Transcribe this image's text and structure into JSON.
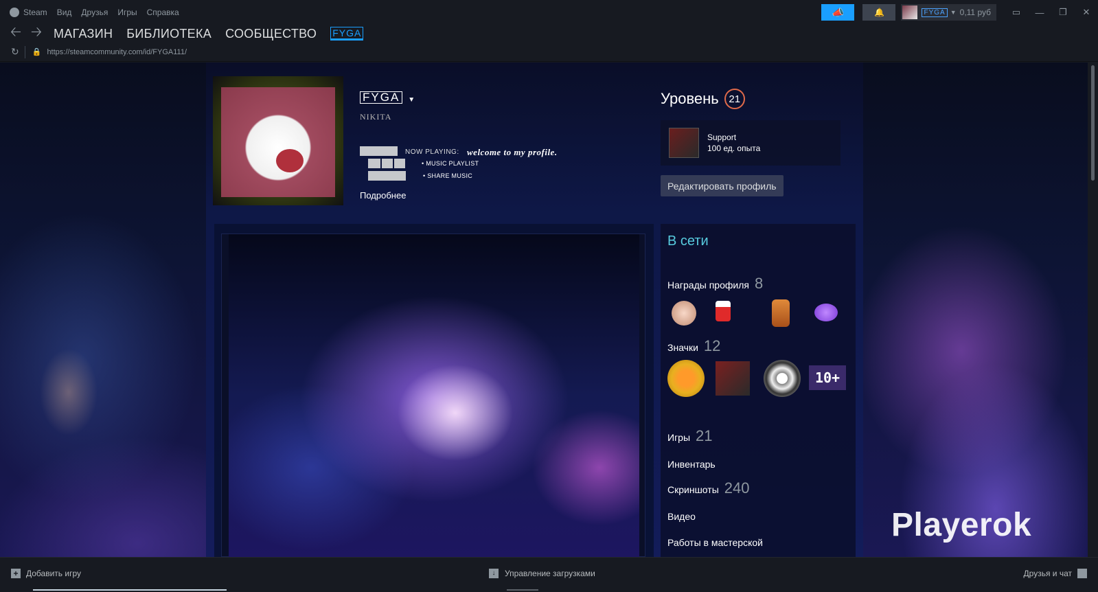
{
  "titlebar": {
    "menu": [
      "Steam",
      "Вид",
      "Друзья",
      "Игры",
      "Справка"
    ],
    "account_name": "FYGA",
    "balance": "0,11 руб"
  },
  "nav": {
    "links": [
      "МАГАЗИН",
      "БИБЛИОТЕКА",
      "СООБЩЕСТВО"
    ],
    "active": "FYGA"
  },
  "url": "https://steamcommunity.com/id/FYGA111/",
  "profile": {
    "persona_name": "FYGA",
    "real_name": "NIKITA",
    "now_playing_label": "NOW PLAYING:",
    "now_playing_value": "welcome to my profile.",
    "music_items": [
      "• MUSIC PLAYLIST",
      "• SHARE MUSIC"
    ],
    "more_link": "Подробнее",
    "level_label": "Уровень",
    "level_value": "21",
    "badge_name": "Support",
    "badge_xp": "100 ед. опыта",
    "edit_button": "Редактировать профиль"
  },
  "right_panel": {
    "status": "В сети",
    "awards_label": "Награды профиля",
    "awards_count": "8",
    "badges_label": "Значки",
    "badges_count": "12",
    "badge_10_label": "10+",
    "games_label": "Игры",
    "games_count": "21",
    "inventory_label": "Инвентарь",
    "screenshots_label": "Скриншоты",
    "screenshots_count": "240",
    "video_label": "Видео",
    "workshop_label": "Работы в мастерской"
  },
  "watermark": "Playerok",
  "bottombar": {
    "add_game": "Добавить игру",
    "downloads": "Управление загрузками",
    "friends": "Друзья и чат"
  },
  "colors": {
    "accent": "#1a9fff",
    "online": "#57cbde",
    "level_ring": "#e06a4a"
  }
}
